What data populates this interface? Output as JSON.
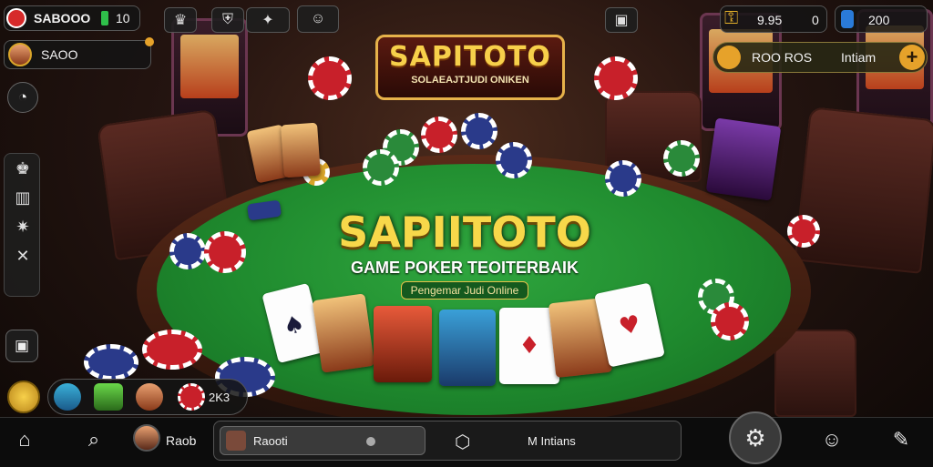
{
  "hud": {
    "top_left_value": "SABOOO",
    "top_left_sub": "10",
    "player_name": "SAOO",
    "top_right_value": "9.95",
    "top_right_sub": "0",
    "top_right_count": "200",
    "bonus_text": "ROO ROS",
    "bonus_label": "Intiam"
  },
  "logos": {
    "top_title": "SAPITOTO",
    "top_sub": "SOLAEAJTJUDI ONIKEN",
    "center_title": "SAPIITOTO",
    "center_sub": "GAME POKER TEOITERBAIK",
    "center_tag": "Pengemar Judi Online"
  },
  "cards": {
    "c1": "♠",
    "c2": "♠",
    "c3": "♦",
    "c4": "♥"
  },
  "player_strip": {
    "bet_value": "2K3"
  },
  "bottom_bar": {
    "user_label": "Raob",
    "search_placeholder": "Raooti",
    "tab_label": "M Intians"
  },
  "colors": {
    "felt": "#1f8a2e",
    "gold": "#f7d84a",
    "accent_green": "#2fa63e",
    "accent_red": "#c8202a"
  }
}
